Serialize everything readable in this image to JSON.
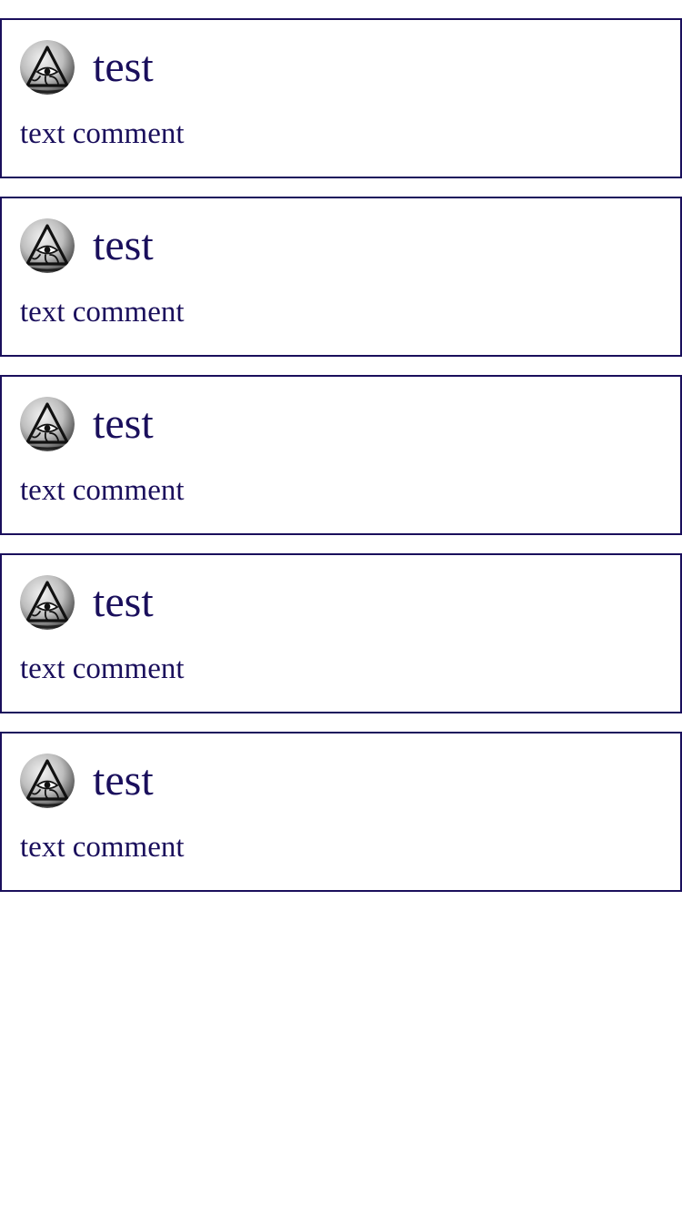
{
  "comments": [
    {
      "author": "test",
      "text": "text comment",
      "avatar_icon": "eye-of-providence-icon"
    },
    {
      "author": "test",
      "text": "text comment",
      "avatar_icon": "eye-of-providence-icon"
    },
    {
      "author": "test",
      "text": "text comment",
      "avatar_icon": "eye-of-providence-icon"
    },
    {
      "author": "test",
      "text": "text comment",
      "avatar_icon": "eye-of-providence-icon"
    },
    {
      "author": "test",
      "text": "text comment",
      "avatar_icon": "eye-of-providence-icon"
    }
  ],
  "colors": {
    "text": "#1a0f5c",
    "border": "#1a0f5c",
    "background": "#ffffff"
  }
}
